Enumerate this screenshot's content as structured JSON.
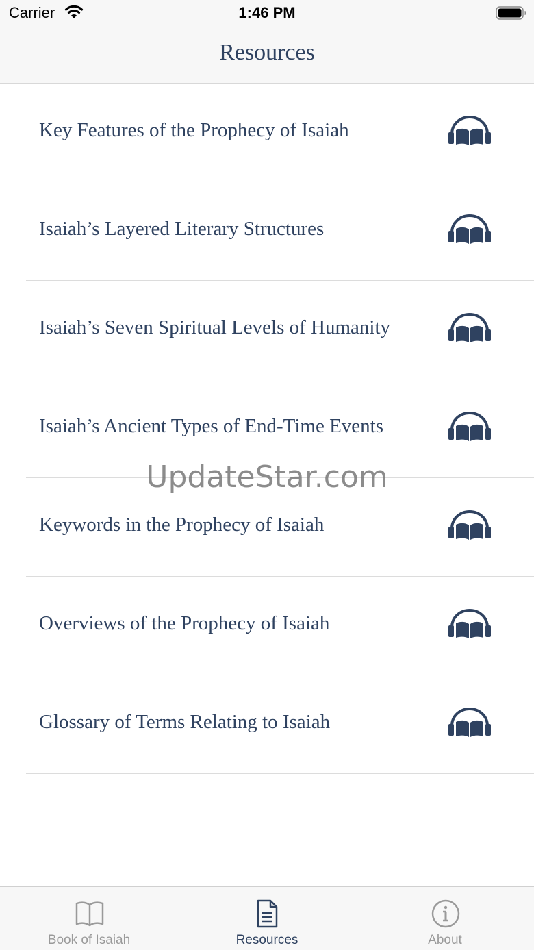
{
  "status_bar": {
    "carrier": "Carrier",
    "time": "1:46 PM"
  },
  "nav": {
    "title": "Resources"
  },
  "resources": [
    {
      "label": "Key Features of the Prophecy of Isaiah",
      "icon": "headphones-book-icon"
    },
    {
      "label": "Isaiah’s Layered Literary Structures",
      "icon": "headphones-book-icon"
    },
    {
      "label": "Isaiah’s Seven Spiritual Levels of Humanity",
      "icon": "headphones-book-icon"
    },
    {
      "label": "Isaiah’s Ancient Types of End-Time Events",
      "icon": "headphones-book-icon"
    },
    {
      "label": "Keywords in the Prophecy of Isaiah",
      "icon": "headphones-book-icon"
    },
    {
      "label": "Overviews of the Prophecy of Isaiah",
      "icon": "headphones-book-icon"
    },
    {
      "label": "Glossary of Terms Relating to Isaiah",
      "icon": "headphones-book-icon"
    }
  ],
  "watermark": "UpdateStar.com",
  "tabs": [
    {
      "label": "Book of Isaiah",
      "icon": "book-icon",
      "active": false
    },
    {
      "label": "Resources",
      "icon": "document-icon",
      "active": true
    },
    {
      "label": "About",
      "icon": "info-icon",
      "active": false
    }
  ],
  "colors": {
    "accent": "#2f4260",
    "inactive": "#9a9a9a",
    "bar_background": "#f7f7f7"
  }
}
